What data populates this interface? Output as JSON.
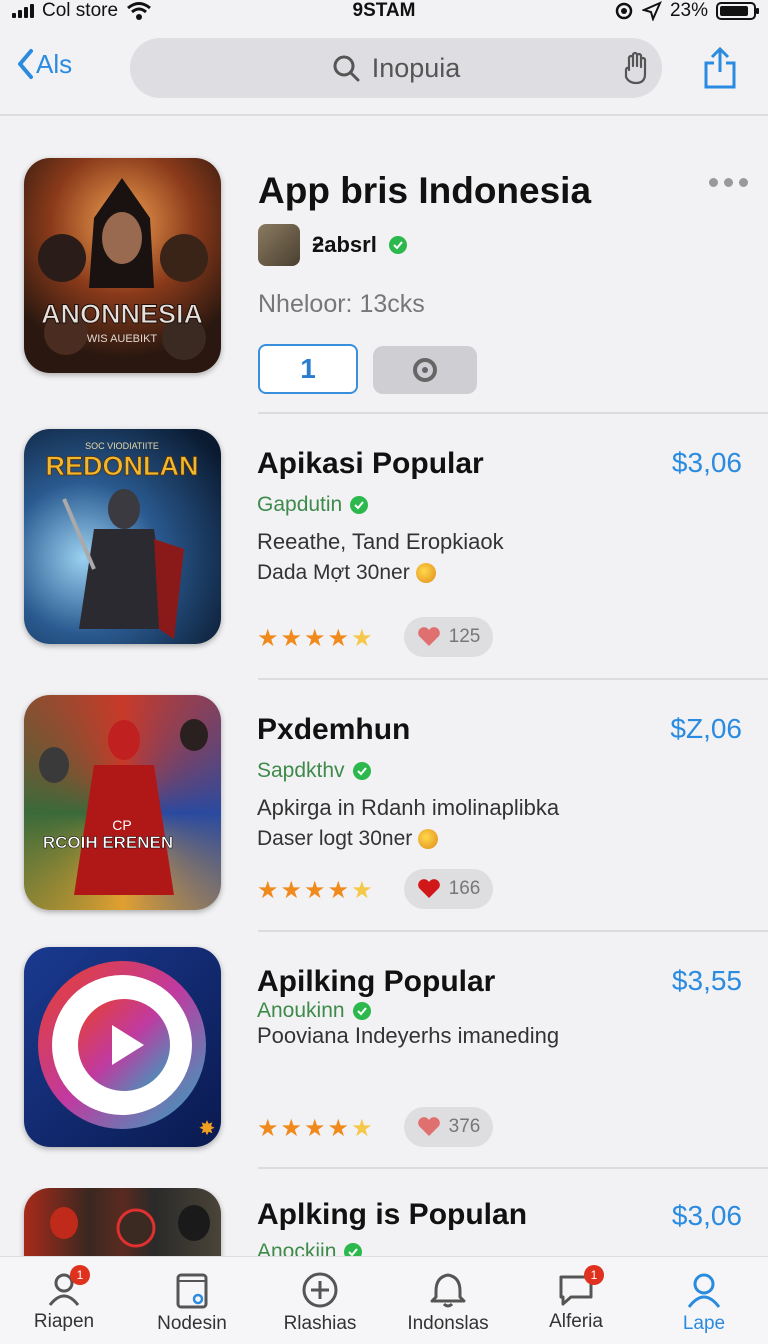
{
  "status_bar": {
    "carrier": "Col store",
    "time": "9STAM",
    "battery": "23%"
  },
  "nav": {
    "back_label": "Als",
    "search_placeholder": "Inopuia"
  },
  "featured": {
    "title": "App bris Indonesia",
    "developer": "ƻabsrl",
    "meta": "Nheloor: 13cks",
    "button_label": "1",
    "art_title": "ANONNESIA",
    "art_subtitle": "WIS AUEBIKT"
  },
  "apps": [
    {
      "name": "Apikasi Popular",
      "price": "$3,06",
      "developer": "Gapdutin",
      "line1": "Reeathe, Tand Eropkiaok",
      "line2": "Dada Mợt 30ner",
      "likes": "125",
      "rating": 4.5,
      "art_title": "REDONLAN",
      "art_top": "SOC VIODIATIITE"
    },
    {
      "name": "Pxdemhun",
      "price": "$Z,06",
      "developer": "Sapdkthv",
      "line1": "Apkirga in Rdanh imolinaplibka",
      "line2": "Daser logt 30ner",
      "likes": "166",
      "rating": 4.5,
      "art_title": "RCOIH ERENEN",
      "art_top": "CP"
    },
    {
      "name": "Apilking Popular",
      "price": "$3,55",
      "developer": "Anoukinn",
      "line1": "Pooviana Indeyerhs imaneding",
      "likes": "376",
      "rating": 4.5
    },
    {
      "name": "Aplking is Populan",
      "price": "$3,06",
      "developer": "Anockiin"
    }
  ],
  "tabs": [
    {
      "label": "Riapen",
      "icon": "person-icon",
      "badge": "1"
    },
    {
      "label": "Nodesin",
      "icon": "apps-icon"
    },
    {
      "label": "Rlashias",
      "icon": "plus-icon"
    },
    {
      "label": "Indonslas",
      "icon": "bell-icon"
    },
    {
      "label": "Alferia",
      "icon": "chat-icon",
      "badge": "1"
    },
    {
      "label": "Lape",
      "icon": "profile-icon",
      "active": true
    }
  ],
  "colors": {
    "accent": "#2a8be0",
    "verified": "#2db84d",
    "star": "#f08a1c",
    "badge": "#e0301e"
  }
}
